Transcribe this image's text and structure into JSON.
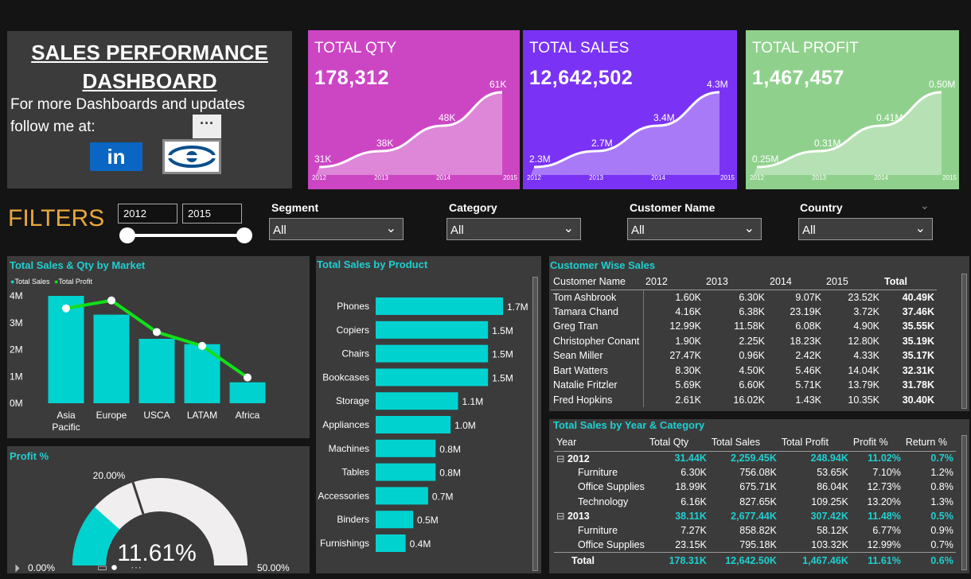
{
  "title": {
    "line1": "SALES PERFORMANCE ",
    "line2": "DASHBOARD",
    "follow1": "For more Dashboards and updates",
    "follow2": "follow me at:",
    "linkedin": "in",
    "more": "···"
  },
  "kpis": [
    {
      "label": "TOTAL QTY",
      "value": "178,312",
      "color": "#cc46c4",
      "points": [
        "31K",
        "38K",
        "48K",
        "61K"
      ],
      "years": [
        "2012",
        "2013",
        "2014",
        "2015"
      ]
    },
    {
      "label": "TOTAL SALES",
      "value": "12,642,502",
      "color": "#7a33f5",
      "points": [
        "2.3M",
        "2.7M",
        "3.4M",
        "4.3M"
      ],
      "years": [
        "2012",
        "2013",
        "2014",
        "2015"
      ]
    },
    {
      "label": "TOTAL PROFIT",
      "value": "1,467,457",
      "color": "#8fd18c",
      "points": [
        "0.25M",
        "0.31M",
        "0.41M",
        "0.50M"
      ],
      "years": [
        "2012",
        "2013",
        "2014",
        "2015"
      ]
    }
  ],
  "filters": {
    "label": "FILTERS",
    "year_from": "2012",
    "year_to": "2015",
    "segment": {
      "label": "Segment",
      "value": "All"
    },
    "category": {
      "label": "Category",
      "value": "All"
    },
    "customer": {
      "label": "Customer Name",
      "value": "All"
    },
    "country": {
      "label": "Country",
      "value": "All"
    }
  },
  "market_chart": {
    "title": "Total Sales & Qty by Market",
    "legend": [
      "Total Sales",
      "Total Profit"
    ],
    "y_ticks": [
      "4M",
      "3M",
      "2M",
      "1M",
      "0M"
    ],
    "categories": [
      "Asia Pacific",
      "Europe",
      "USCA",
      "LATAM",
      "Africa"
    ],
    "cat_lines": [
      [
        "Asia",
        "Pacific"
      ],
      [
        "Europe"
      ],
      [
        "USCA"
      ],
      [
        "LATAM"
      ],
      [
        "Africa"
      ]
    ]
  },
  "chart_data": [
    {
      "type": "bar",
      "title": "Total Sales & Qty by Market",
      "categories": [
        "Asia Pacific",
        "Europe",
        "USCA",
        "LATAM",
        "Africa"
      ],
      "series": [
        {
          "name": "Total Sales",
          "values": [
            4.0,
            3.3,
            2.4,
            2.2,
            0.78
          ]
        },
        {
          "name": "Total Profit",
          "values": [
            0.44,
            0.48,
            0.32,
            0.25,
            0.09
          ]
        }
      ],
      "ylim": [
        0,
        4.5
      ]
    },
    {
      "type": "bar",
      "title": "Total Sales by Product",
      "categories": [
        "Phones",
        "Copiers",
        "Chairs",
        "Bookcases",
        "Storage",
        "Appliances",
        "Machines",
        "Tables",
        "Accessories",
        "Binders",
        "Furnishings"
      ],
      "values": [
        1.7,
        1.5,
        1.5,
        1.5,
        1.1,
        1.0,
        0.8,
        0.8,
        0.7,
        0.5,
        0.4
      ],
      "labels": [
        "1.7M",
        "1.5M",
        "1.5M",
        "1.5M",
        "1.1M",
        "1.0M",
        "0.8M",
        "0.8M",
        "0.7M",
        "0.5M",
        "0.4M"
      ]
    },
    {
      "type": "gauge",
      "title": "Profit %",
      "value": 11.61,
      "min": 0,
      "max": 50,
      "target": 20,
      "labels": {
        "value": "11.61%",
        "min": "0.00%",
        "max": "50.00%",
        "target": "20.00%"
      }
    }
  ],
  "customer_table": {
    "title": "Customer Wise Sales",
    "headers": [
      "Customer Name",
      "2012",
      "2013",
      "2014",
      "2015",
      "Total"
    ],
    "rows": [
      [
        "Tom Ashbrook",
        "1.60K",
        "6.30K",
        "9.07K",
        "23.52K",
        "40.49K"
      ],
      [
        "Tamara Chand",
        "4.16K",
        "6.38K",
        "23.19K",
        "3.72K",
        "37.46K"
      ],
      [
        "Greg Tran",
        "12.99K",
        "11.58K",
        "6.08K",
        "4.90K",
        "35.55K"
      ],
      [
        "Christopher Conant",
        "1.90K",
        "2.25K",
        "18.23K",
        "12.80K",
        "35.19K"
      ],
      [
        "Sean Miller",
        "27.47K",
        "0.96K",
        "2.42K",
        "4.33K",
        "35.17K"
      ],
      [
        "Bart Watters",
        "8.30K",
        "4.50K",
        "5.46K",
        "14.04K",
        "32.31K"
      ],
      [
        "Natalie Fritzler",
        "5.69K",
        "6.60K",
        "5.71K",
        "13.79K",
        "31.78K"
      ],
      [
        "Fred Hopkins",
        "2.61K",
        "16.02K",
        "1.43K",
        "10.35K",
        "30.40K"
      ]
    ]
  },
  "year_table": {
    "title": "Total Sales by Year & Category",
    "headers": [
      "Year",
      "Total Qty",
      "Total Sales",
      "Total Profit",
      "Profit %",
      "Return %"
    ],
    "rows": [
      {
        "kind": "group",
        "expander": "⊟",
        "cells": [
          "2012",
          "31.44K",
          "2,259.45K",
          "248.94K",
          "11.02%",
          "0.7%"
        ]
      },
      {
        "kind": "child",
        "cells": [
          "Furniture",
          "6.30K",
          "756.08K",
          "53.65K",
          "7.10%",
          "1.2%"
        ]
      },
      {
        "kind": "child",
        "cells": [
          "Office Supplies",
          "18.99K",
          "675.71K",
          "86.04K",
          "12.73%",
          "0.8%"
        ]
      },
      {
        "kind": "child",
        "cells": [
          "Technology",
          "6.16K",
          "827.65K",
          "109.25K",
          "13.20%",
          "1.3%"
        ]
      },
      {
        "kind": "group",
        "expander": "⊟",
        "cells": [
          "2013",
          "38.11K",
          "2,677.44K",
          "307.42K",
          "11.48%",
          "0.5%"
        ]
      },
      {
        "kind": "child",
        "cells": [
          "Furniture",
          "7.27K",
          "858.82K",
          "58.12K",
          "6.77%",
          "0.9%"
        ]
      },
      {
        "kind": "child",
        "cells": [
          "Office Supplies",
          "23.15K",
          "795.18K",
          "103.32K",
          "12.99%",
          "0.7%"
        ]
      }
    ],
    "total": [
      "Total",
      "178.31K",
      "12,642.50K",
      "1,467.46K",
      "11.61%",
      "0.6%"
    ]
  },
  "profit_gauge": {
    "title": "Profit %"
  },
  "product_chart": {
    "title": "Total Sales by Product"
  }
}
